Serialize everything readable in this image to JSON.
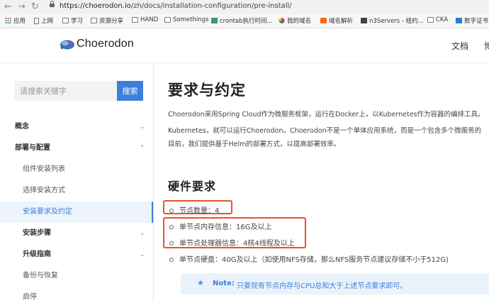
{
  "browser": {
    "url_host": "https://choerodon.io",
    "url_path": "/zh/docs/installation-configuration/pre-install/",
    "bookmarks": [
      {
        "label": "应用",
        "icon": "apps-grid-icon"
      },
      {
        "label": "上网",
        "icon": "page-icon"
      },
      {
        "label": "学习",
        "icon": "folder-icon"
      },
      {
        "label": "资源分享",
        "icon": "folder-icon"
      },
      {
        "label": "HAND",
        "icon": "folder-icon"
      },
      {
        "label": "Somethings",
        "icon": "folder-icon"
      },
      {
        "label": "crontab执行时间...",
        "icon": "crontab-icon"
      },
      {
        "label": "我的域名",
        "icon": "pinwheel-icon"
      },
      {
        "label": "域名解析",
        "icon": "orange-n-icon"
      },
      {
        "label": "n3Servers - 纽约...",
        "icon": "server-icon"
      },
      {
        "label": "CKA",
        "icon": "folder-icon"
      },
      {
        "label": "数字证书",
        "icon": "cert-icon"
      }
    ]
  },
  "header": {
    "logo_text": "Choerodon",
    "nav_docs": "文档",
    "nav_blog": "博"
  },
  "sidebar": {
    "search_placeholder": "请搜索关键字",
    "search_button": "搜索",
    "items": [
      {
        "label": "概念",
        "chevron": "⌄"
      },
      {
        "label": "部署与配置",
        "chevron": "⌃"
      },
      {
        "label": "组件安装列表",
        "chevron": ""
      },
      {
        "label": "选择安装方式",
        "chevron": ""
      },
      {
        "label": "安装要求及约定",
        "chevron": ""
      },
      {
        "label": "安装步骤",
        "chevron": "⌄"
      },
      {
        "label": "升级指南",
        "chevron": "⌄"
      },
      {
        "label": "备份与恢复",
        "chevron": ""
      },
      {
        "label": "启停",
        "chevron": ""
      }
    ]
  },
  "content": {
    "title": "要求与约定",
    "intro_line1": "Choerodon采用Spring Cloud作为微服务框架，运行在Docker上，以Kubernetes作为容器的编排工具。",
    "intro_line2": "Kubernetes，就可以运行Choerodon。Choerodon不是一个单体应用系统，而是一个包含多个微服务的",
    "intro_line3": "目前，我们提供基于Helm的部署方式，以提高部署效率。",
    "hardware_heading": "硬件要求",
    "bullets": [
      "节点数量：4",
      "单节点内存信息：16G及以上",
      "单节点处理器信息：4核4线程及以上",
      "单节点硬盘：40G及以上（如使用NFS存储，那么NFS服务节点建议存储不小于512G)"
    ],
    "note_label": "Note:",
    "note_text": "只要现有节点内存与CPU总和大于上述节点要求即可。"
  },
  "colors": {
    "accent": "#3d7fd9",
    "highlight_box": "#e4532e",
    "note_bg": "#eaf3fc"
  }
}
